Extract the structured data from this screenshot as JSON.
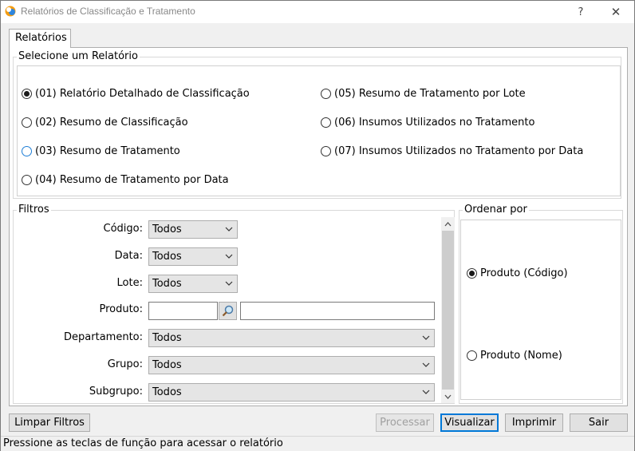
{
  "window": {
    "title": "Relatórios de Classificação e Tratamento",
    "help_glyph": "?",
    "close_glyph": "✕"
  },
  "tab": {
    "label": "Relatórios"
  },
  "report_group": {
    "label": "Selecione um Relatório",
    "options": [
      {
        "label": "(01) Relatório Detalhado de Classificação",
        "checked": true
      },
      {
        "label": "(02) Resumo de Classificação",
        "checked": false
      },
      {
        "label": "(03) Resumo de Tratamento",
        "checked": false,
        "focused": true
      },
      {
        "label": "(04) Resumo de Tratamento por Data",
        "checked": false
      },
      {
        "label": "(05) Resumo de Tratamento por Lote",
        "checked": false
      },
      {
        "label": "(06) Insumos Utilizados no Tratamento",
        "checked": false
      },
      {
        "label": "(07) Insumos Utilizados no Tratamento por Data",
        "checked": false
      }
    ]
  },
  "filters": {
    "label": "Filtros",
    "codigo": {
      "label": "Código:",
      "value": "Todos"
    },
    "data": {
      "label": "Data:",
      "value": "Todos"
    },
    "lote": {
      "label": "Lote:",
      "value": "Todos"
    },
    "produto": {
      "label": "Produto:",
      "code_value": "",
      "name_value": ""
    },
    "departamento": {
      "label": "Departamento:",
      "value": "Todos"
    },
    "grupo": {
      "label": "Grupo:",
      "value": "Todos"
    },
    "subgrupo": {
      "label": "Subgrupo:",
      "value": "Todos"
    }
  },
  "order": {
    "label": "Ordenar por",
    "options": [
      {
        "label": "Produto (Código)",
        "checked": true
      },
      {
        "label": "Produto (Nome)",
        "checked": false
      }
    ]
  },
  "buttons": {
    "clear": "Limpar Filtros",
    "process": "Processar",
    "view": "Visualizar",
    "print": "Imprimir",
    "exit": "Sair"
  },
  "status": {
    "text": "Pressione as teclas de função para acessar o relatório"
  },
  "colors": {
    "focus": "#0078d7",
    "panel": "#ffffff",
    "chrome": "#f0f0f0"
  }
}
